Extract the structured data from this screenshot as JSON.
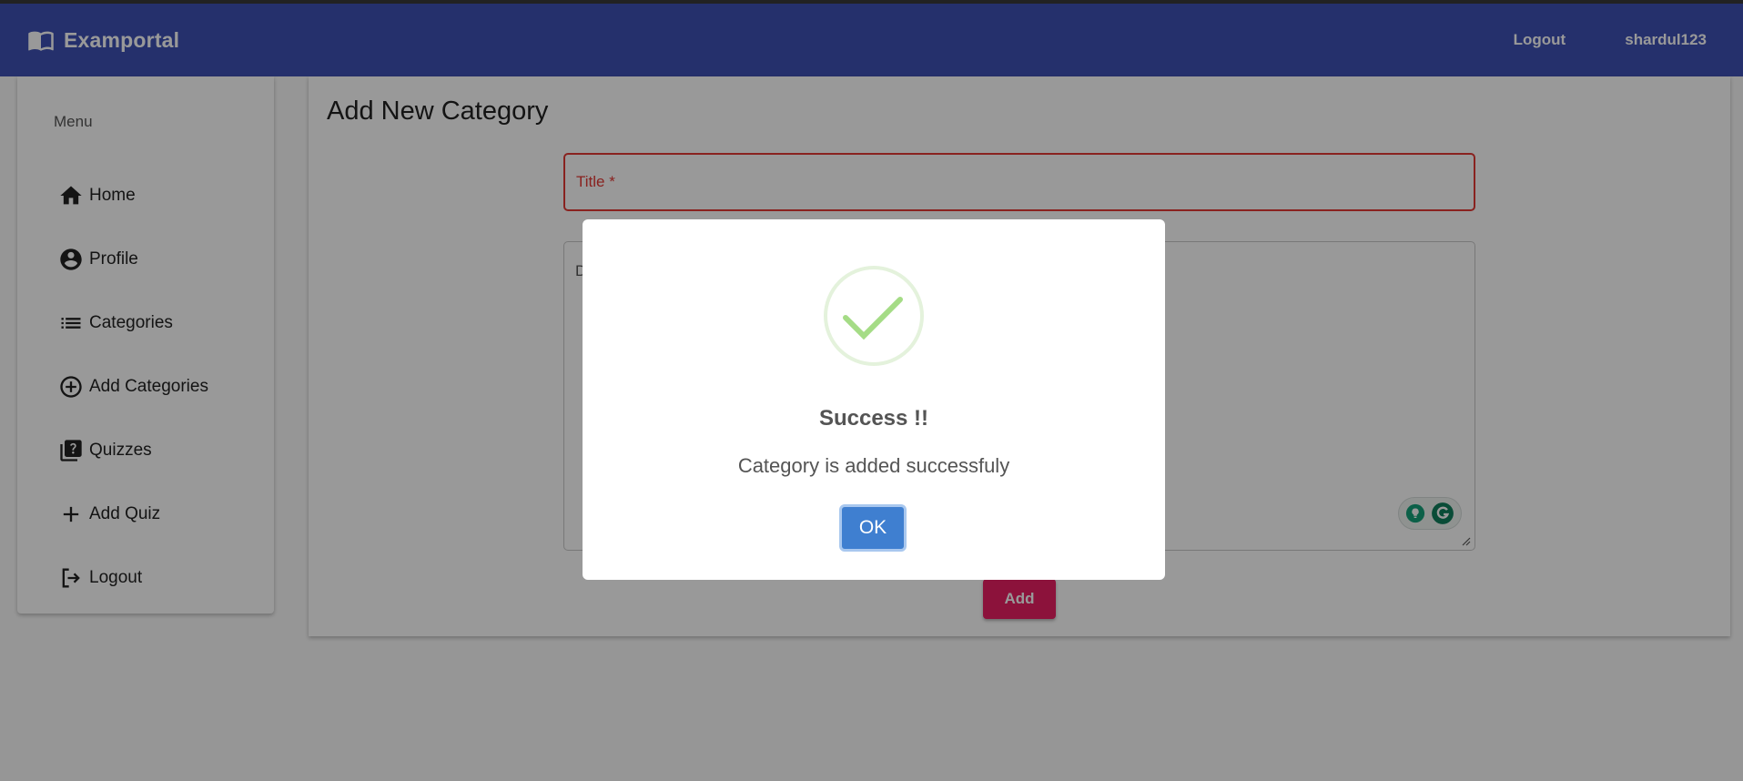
{
  "navbar": {
    "brand": "Examportal",
    "brand_icon": "book-icon",
    "logout_label": "Logout",
    "username": "shardul123",
    "color": "#3f51b5"
  },
  "sidebar": {
    "menu_title": "Menu",
    "items": [
      {
        "label": "Home",
        "icon": "home-icon"
      },
      {
        "label": "Profile",
        "icon": "account-circle-icon"
      },
      {
        "label": "Categories",
        "icon": "list-icon"
      },
      {
        "label": "Add Categories",
        "icon": "add-circle-outline-icon"
      },
      {
        "label": "Quizzes",
        "icon": "quiz-library-icon"
      },
      {
        "label": "Add Quiz",
        "icon": "plus-icon"
      },
      {
        "label": "Logout",
        "icon": "logout-icon"
      }
    ]
  },
  "main": {
    "page_title": "Add New Category",
    "title_field_label": "Title *",
    "description_placeholder": "D",
    "add_button_label": "Add",
    "accent_color": "#e91e63",
    "error_color": "#e53935"
  },
  "dialog": {
    "title": "Success !!",
    "message": "Category is added successfuly",
    "ok_label": "OK",
    "icon": "success-check-icon",
    "button_color": "#3f7fd0"
  }
}
